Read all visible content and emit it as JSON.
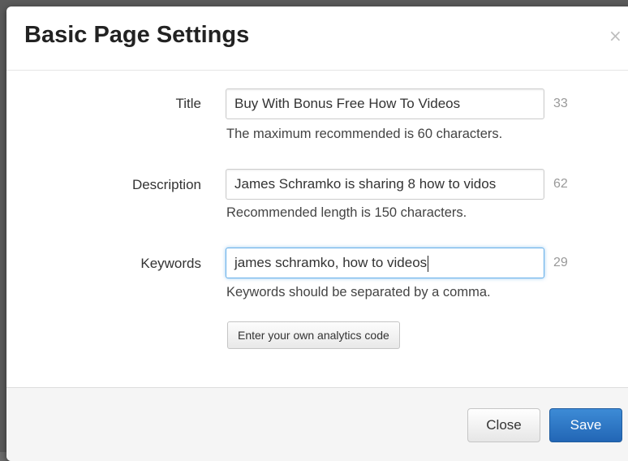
{
  "dialog": {
    "title": "Basic Page Settings",
    "close_glyph": "×"
  },
  "fields": {
    "title": {
      "label": "Title",
      "value": "Buy With Bonus Free How To Videos",
      "count": "33",
      "help": "The maximum recommended is 60 characters."
    },
    "description": {
      "label": "Description",
      "value": "James Schramko is sharing 8 how to vidos",
      "count": "62",
      "help": "Recommended length is 150 characters."
    },
    "keywords": {
      "label": "Keywords",
      "value": "james schramko, how to videos",
      "count": "29",
      "help": "Keywords should be separated by a comma."
    }
  },
  "analytics_button": "Enter your own analytics code",
  "footer": {
    "close_label": "Close",
    "save_label": "Save"
  },
  "colors": {
    "primary": "#2266b5",
    "focus": "#66afe9"
  },
  "icons": {
    "close": "close-icon"
  }
}
